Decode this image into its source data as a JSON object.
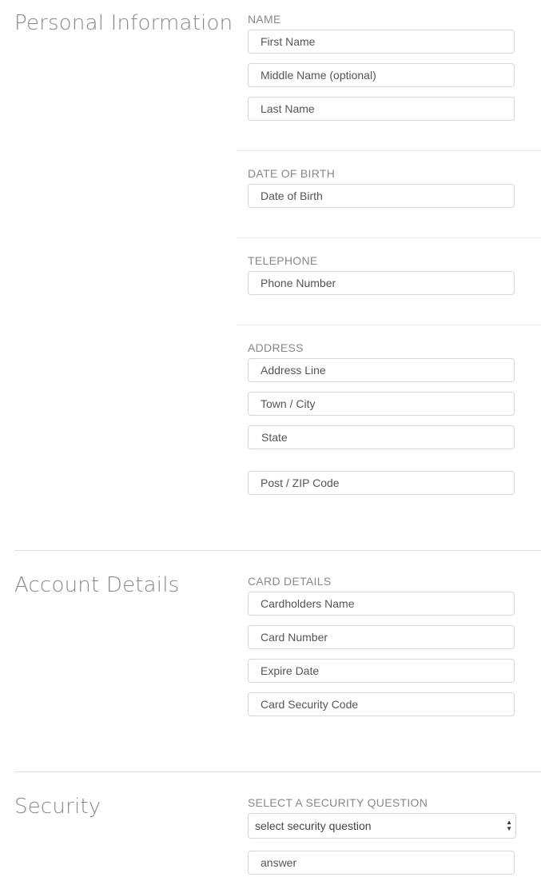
{
  "sections": {
    "personal": {
      "title": "Personal Information",
      "name": {
        "label": "NAME",
        "first_placeholder": "First Name",
        "middle_placeholder": "Middle Name (optional)",
        "last_placeholder": "Last Name"
      },
      "dob": {
        "label": "DATE OF BIRTH",
        "placeholder": "Date of Birth"
      },
      "telephone": {
        "label": "TELEPHONE",
        "placeholder": "Phone Number"
      },
      "address": {
        "label": "ADDRESS",
        "line_placeholder": "Address Line",
        "city_placeholder": "Town / City",
        "state_placeholder": "State",
        "zip_placeholder": "Post / ZIP Code"
      }
    },
    "account": {
      "title": "Account Details",
      "card": {
        "label": "CARD DETAILS",
        "holder_placeholder": "Cardholders Name",
        "number_placeholder": "Card Number",
        "expire_placeholder": "Expire Date",
        "cvc_placeholder": "Card Security Code"
      }
    },
    "security": {
      "title": "Security",
      "question": {
        "label": "SELECT A SECURITY QUESTION",
        "selected": "select security question",
        "icon": "select-arrows-icon"
      },
      "answer_placeholder": "answer"
    }
  }
}
